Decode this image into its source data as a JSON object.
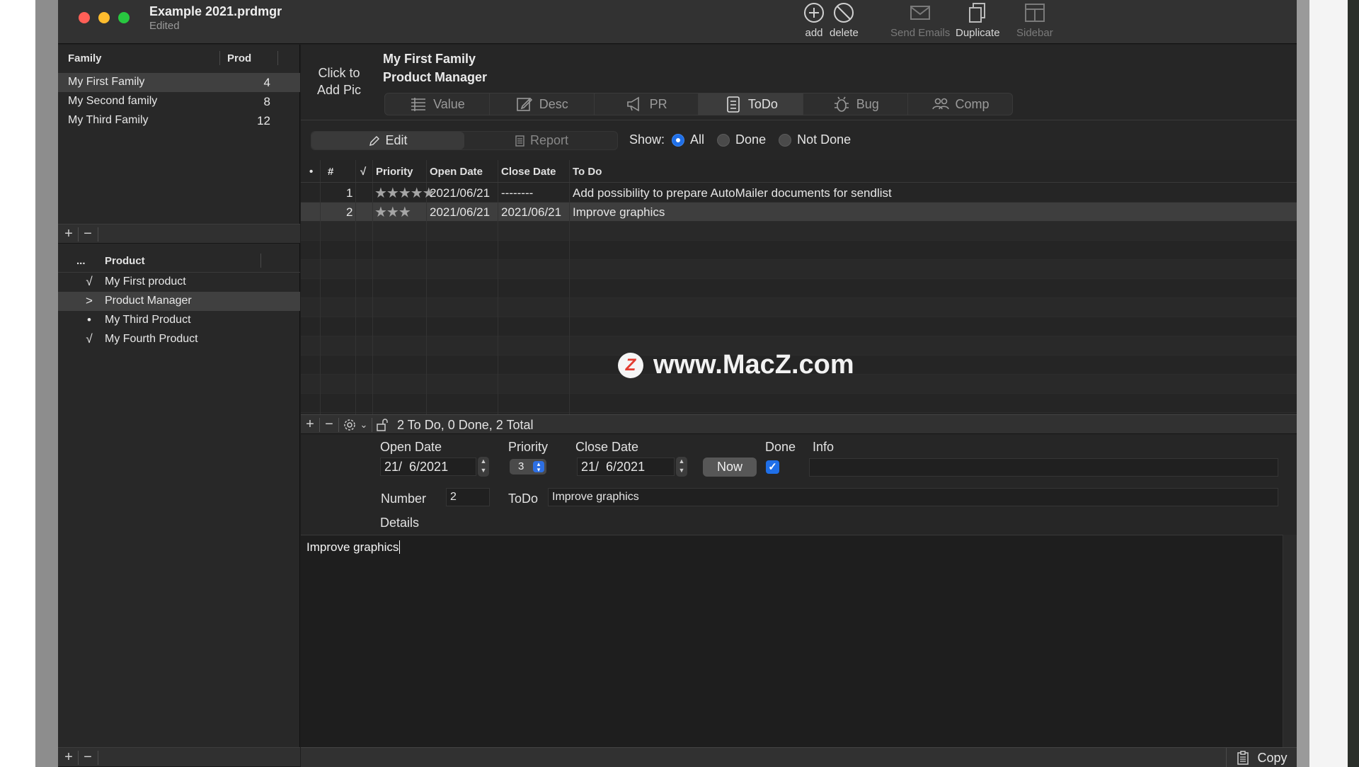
{
  "window": {
    "title": "Example 2021.prdmgr",
    "subtitle": "Edited"
  },
  "toolbar": {
    "add": "add",
    "delete": "delete",
    "send_emails": "Send Emails",
    "duplicate": "Duplicate",
    "sidebar": "Sidebar"
  },
  "families": {
    "col_family": "Family",
    "col_prod": "Prod",
    "rows": [
      {
        "name": "My First Family",
        "count": "4"
      },
      {
        "name": "My Second family",
        "count": "8"
      },
      {
        "name": "My Third Family",
        "count": "12"
      }
    ]
  },
  "products": {
    "col_status": "...",
    "col_product": "Product",
    "rows": [
      {
        "mark": "√",
        "name": "My First product"
      },
      {
        "mark": ">",
        "name": "Product Manager"
      },
      {
        "mark": "•",
        "name": "My Third Product"
      },
      {
        "mark": "√",
        "name": "My Fourth Product"
      }
    ]
  },
  "header": {
    "pic_line1": "Click to",
    "pic_line2": "Add Pic",
    "family": "My First Family",
    "product": "Product Manager"
  },
  "tabs": [
    "Value",
    "Desc",
    "PR",
    "ToDo",
    "Bug",
    "Comp"
  ],
  "mode": {
    "edit": "Edit",
    "report": "Report"
  },
  "show": {
    "label": "Show:",
    "all": "All",
    "done": "Done",
    "not_done": "Not Done"
  },
  "table": {
    "headers": {
      "dot": "•",
      "num": "#",
      "check": "√",
      "priority": "Priority",
      "open": "Open Date",
      "close": "Close Date",
      "todo": "To Do"
    },
    "rows": [
      {
        "num": "1",
        "stars": "★★★★★",
        "open": "2021/06/21",
        "close": "--------",
        "todo": "Add possibility to prepare AutoMailer documents for sendlist"
      },
      {
        "num": "2",
        "stars": "★★★",
        "open": "2021/06/21",
        "close": "2021/06/21",
        "todo": "Improve graphics"
      }
    ],
    "status": "2 To Do, 0 Done, 2 Total"
  },
  "watermark": {
    "logo": "Z",
    "text": "www.MacZ.com"
  },
  "form": {
    "open_label": "Open Date",
    "open_value": "21/  6/2021",
    "priority_label": "Priority",
    "priority_value": "3",
    "close_label": "Close Date",
    "close_value": "21/  6/2021",
    "now_button": "Now",
    "done_label": "Done",
    "info_label": "Info",
    "info_value": "",
    "number_label": "Number",
    "number_value": "2",
    "todo_label": "ToDo",
    "todo_value": "Improve graphics",
    "details_label": "Details",
    "details_text": "Improve graphics"
  },
  "footer": {
    "copy": "Copy"
  }
}
